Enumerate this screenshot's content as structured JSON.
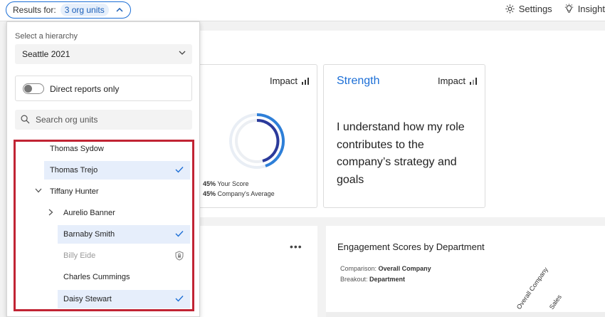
{
  "topbar": {
    "results_label": "Results for:",
    "units_badge": "3 org units",
    "settings_label": "Settings",
    "insights_label": "Insight"
  },
  "dropdown": {
    "hierarchy_label": "Select a hierarchy",
    "hierarchy_value": "Seattle 2021",
    "direct_reports_label": "Direct reports only",
    "direct_reports_on": false,
    "search_placeholder": "Search org units",
    "tree": [
      {
        "label": "Thomas Sydow",
        "selected": false
      },
      {
        "label": "Thomas Trejo",
        "selected": true
      },
      {
        "label": "Tiffany Hunter",
        "selected": false,
        "expanded": true
      },
      {
        "label": "Aurelio Banner",
        "selected": false,
        "expanded": false
      },
      {
        "label": "Barnaby Smith",
        "selected": true
      },
      {
        "label": "Billy Eide",
        "selected": false,
        "locked": true
      },
      {
        "label": "Charles Cummings",
        "selected": false
      },
      {
        "label": "Daisy Stewart",
        "selected": true
      }
    ]
  },
  "cards": {
    "impact_label": "Impact",
    "score_card": {
      "your_score_pct": "45%",
      "your_score_label": "Your Score",
      "company_avg_pct": "45%",
      "company_avg_label": "Company's Average"
    },
    "strength_card": {
      "title": "Strength",
      "impact_label": "Impact",
      "statement": "I understand how my role contributes to the company’s strategy and goals"
    },
    "engagement": {
      "title": "Engagement Scores by Department",
      "comparison_label": "Comparison:",
      "comparison_value": "Overall Company",
      "breakout_label": "Breakout:",
      "breakout_value": "Department",
      "columns": [
        "Overall Company",
        "Sales"
      ]
    },
    "more_menu": "•••"
  },
  "colors": {
    "accent": "#1b6ed6",
    "highlight_border": "#c12434",
    "selected_bg": "#e6eefb"
  }
}
